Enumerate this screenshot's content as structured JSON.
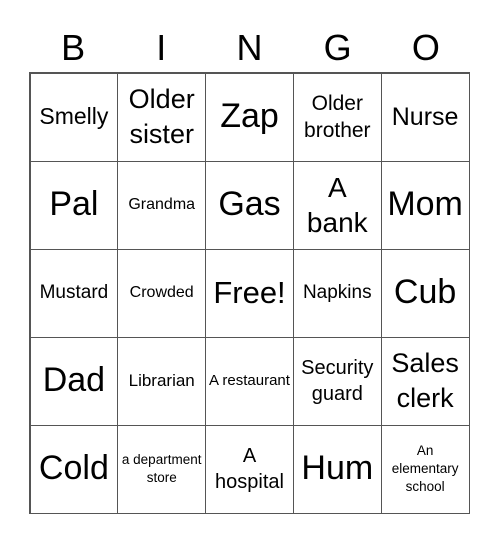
{
  "header": [
    "B",
    "I",
    "N",
    "G",
    "O"
  ],
  "cells": [
    "Smelly",
    "Older sister",
    "Zap",
    "Older brother",
    "Nurse",
    "Pal",
    "Grandma",
    "Gas",
    "A bank",
    "Mom",
    "Mustard",
    "Crowded",
    "Free!",
    "Napkins",
    "Cub",
    "Dad",
    "Librarian",
    "A restaurant",
    "Security guard",
    "Sales clerk",
    "Cold",
    "a department store",
    "A hospital",
    "Hum",
    "An elementary school"
  ]
}
